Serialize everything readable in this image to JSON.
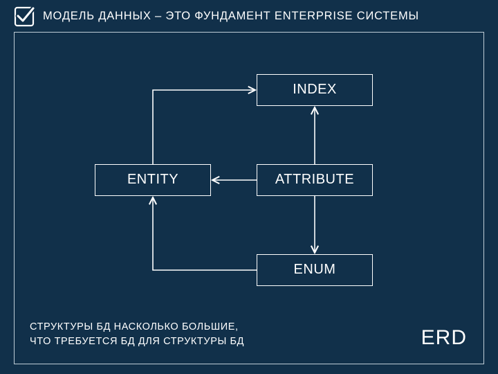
{
  "title": "МОДЕЛЬ ДАННЫХ – ЭТО ФУНДАМЕНТ ENTERPRISE СИСТЕМЫ",
  "nodes": {
    "index": "INDEX",
    "entity": "ENTITY",
    "attribute": "ATTRIBUTE",
    "enum": "ENUM"
  },
  "caption_line1": "СТРУКТУРЫ БД НАСКОЛЬКО БОЛЬШИЕ,",
  "caption_line2": "ЧТО ТРЕБУЕТСЯ БД ДЛЯ СТРУКТУРЫ БД",
  "corner_label": "ERD",
  "edges": [
    {
      "from": "attribute",
      "to": "entity"
    },
    {
      "from": "attribute",
      "to": "index"
    },
    {
      "from": "attribute",
      "to": "enum"
    },
    {
      "from": "entity",
      "to": "index",
      "path": "up-right"
    },
    {
      "from": "enum",
      "to": "entity",
      "path": "left-up"
    }
  ]
}
